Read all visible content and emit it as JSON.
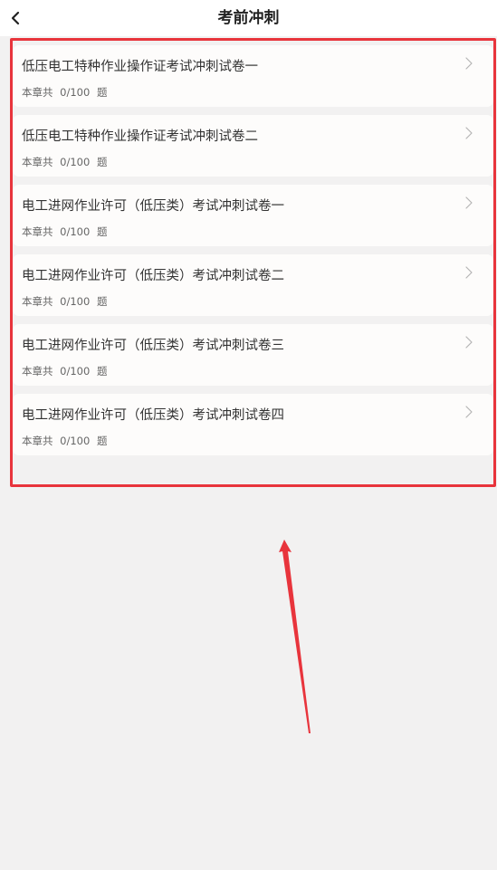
{
  "header": {
    "title": "考前冲刺",
    "back_icon": "chevron-left-icon"
  },
  "items": [
    {
      "title": "低压电工特种作业操作证考试冲刺试卷一",
      "prefix": "本章共",
      "progress": "0/100",
      "suffix": "题"
    },
    {
      "title": "低压电工特种作业操作证考试冲刺试卷二",
      "prefix": "本章共",
      "progress": "0/100",
      "suffix": "题"
    },
    {
      "title": "电工进网作业许可（低压类）考试冲刺试卷一",
      "prefix": "本章共",
      "progress": "0/100",
      "suffix": "题"
    },
    {
      "title": "电工进网作业许可（低压类）考试冲刺试卷二",
      "prefix": "本章共",
      "progress": "0/100",
      "suffix": "题"
    },
    {
      "title": "电工进网作业许可（低压类）考试冲刺试卷三",
      "prefix": "本章共",
      "progress": "0/100",
      "suffix": "题"
    },
    {
      "title": "电工进网作业许可（低压类）考试冲刺试卷四",
      "prefix": "本章共",
      "progress": "0/100",
      "suffix": "题"
    }
  ],
  "colors": {
    "background": "#f2f1f1",
    "card": "#fdfcfb",
    "annotation_red": "#e8343c"
  }
}
